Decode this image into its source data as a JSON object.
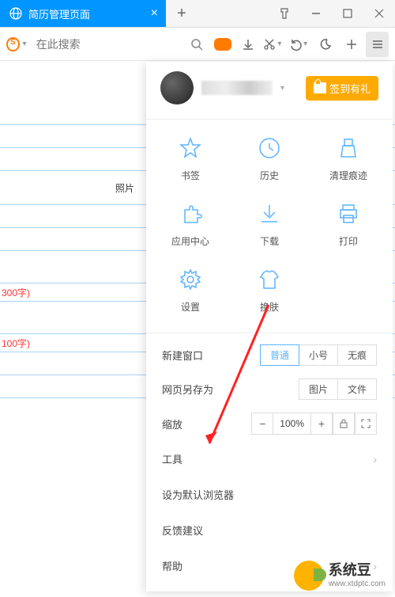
{
  "tab": {
    "title": "简历管理页面",
    "close": "×"
  },
  "toolbar": {
    "search_placeholder": "在此搜索"
  },
  "content": {
    "photo_label": "照片",
    "note_300": "300字)",
    "note_100": "100字)"
  },
  "menu": {
    "checkin": "签到有礼",
    "grid": {
      "bookmarks": "书签",
      "history": "历史",
      "clear": "清理痕迹",
      "appcenter": "应用中心",
      "download": "下载",
      "print": "打印",
      "settings": "设置",
      "skin": "换肤"
    },
    "new_window": {
      "label": "新建窗口",
      "normal": "普通",
      "small": "小号",
      "incognito": "无痕"
    },
    "save_as": {
      "label": "网页另存为",
      "image": "图片",
      "file": "文件"
    },
    "zoom": {
      "label": "缩放",
      "value": "100%"
    },
    "tools": "工具",
    "default_browser": "设为默认浏览器",
    "feedback": "反馈建议",
    "help": "帮助"
  },
  "watermark": {
    "name": "系统豆",
    "url": "www.xtdptc.com"
  }
}
